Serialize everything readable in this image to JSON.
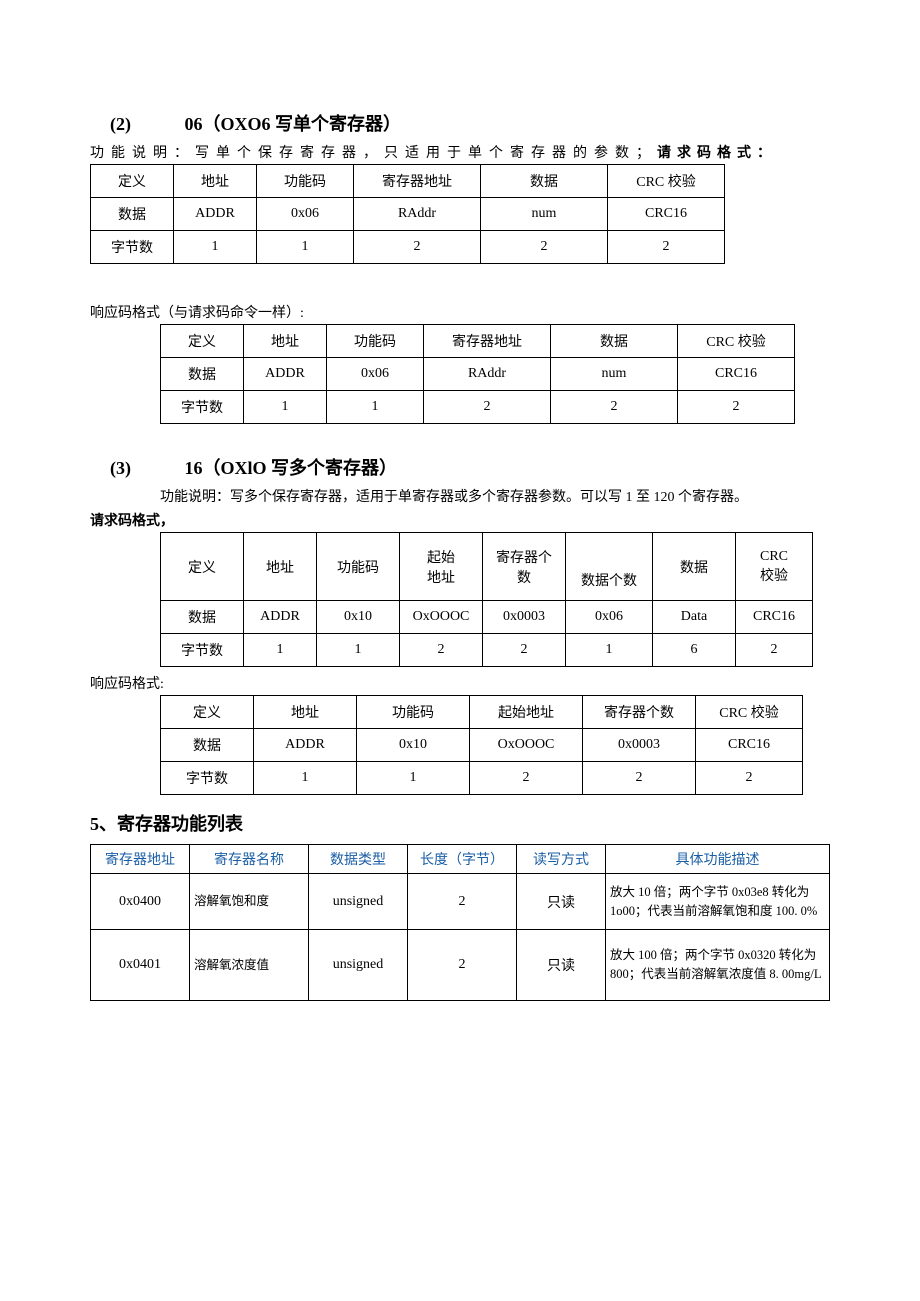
{
  "s2": {
    "num": "(2)",
    "title": "06（OXO6 写单个寄存器）",
    "desc_prefix": "功能说明：写单个保存寄存器，只适用于单个寄存器的参数；",
    "desc_suffix": "请求码格式：",
    "table_req": {
      "r0": [
        "定义",
        "地址",
        "功能码",
        "寄存器地址",
        "数据",
        "CRC 校验"
      ],
      "r1": [
        "数据",
        "ADDR",
        "0x06",
        "RAddr",
        "num",
        "CRC16"
      ],
      "r2": [
        "字节数",
        "1",
        "1",
        "2",
        "2",
        "2"
      ]
    },
    "response_label": "响应码格式（与请求码命令一样）:",
    "table_resp": {
      "r0": [
        "定义",
        "地址",
        "功能码",
        "寄存器地址",
        "数据",
        "CRC 校验"
      ],
      "r1": [
        "数据",
        "ADDR",
        "0x06",
        "RAddr",
        "num",
        "CRC16"
      ],
      "r2": [
        "字节数",
        "1",
        "1",
        "2",
        "2",
        "2"
      ]
    }
  },
  "s3": {
    "num": "(3)",
    "title": "16（OXlO 写多个寄存器）",
    "desc": "功能说明：写多个保存寄存器，适用于单寄存器或多个寄存器参数。可以写 1 至 120 个寄存器。",
    "req_label": "请求码格式，",
    "table_req": {
      "r0": [
        "定义",
        "地址",
        "功能码",
        "起始地址",
        "寄存器个数",
        "数据个数",
        "数据",
        "CRC校验"
      ],
      "r1": [
        "数据",
        "ADDR",
        "0x10",
        "OxOOOC",
        "0x0003",
        "0x06",
        "Data",
        "CRC16"
      ],
      "r2": [
        "字节数",
        "1",
        "1",
        "2",
        "2",
        "1",
        "6",
        "2"
      ]
    },
    "response_label": "响应码格式:",
    "table_resp": {
      "r0": [
        "定义",
        "地址",
        "功能码",
        "起始地址",
        "寄存器个数",
        "CRC 校验"
      ],
      "r1": [
        "数据",
        "ADDR",
        "0x10",
        "OxOOOC",
        "0x0003",
        "CRC16"
      ],
      "r2": [
        "字节数",
        "1",
        "1",
        "2",
        "2",
        "2"
      ]
    }
  },
  "s5": {
    "title": "5、寄存器功能列表",
    "headers": [
      "寄存器地址",
      "寄存器名称",
      "数据类型",
      "长度（字节）",
      "读写方式",
      "具体功能描述"
    ],
    "rows": [
      {
        "addr": "0x0400",
        "name": "溶解氧饱和度",
        "type": "unsigned",
        "len": "2",
        "rw": "只读",
        "desc": "放大 10 倍；两个字节 0x03e8 转化为 1o00；代表当前溶解氧饱和度 100. 0%"
      },
      {
        "addr": "0x0401",
        "name": "溶解氧浓度值",
        "type": "unsigned",
        "len": "2",
        "rw": "只读",
        "desc": "放大 100 倍；两个字节 0x0320 转化为 800；代表当前溶解氧浓度值 8. 00mg/L"
      }
    ]
  }
}
